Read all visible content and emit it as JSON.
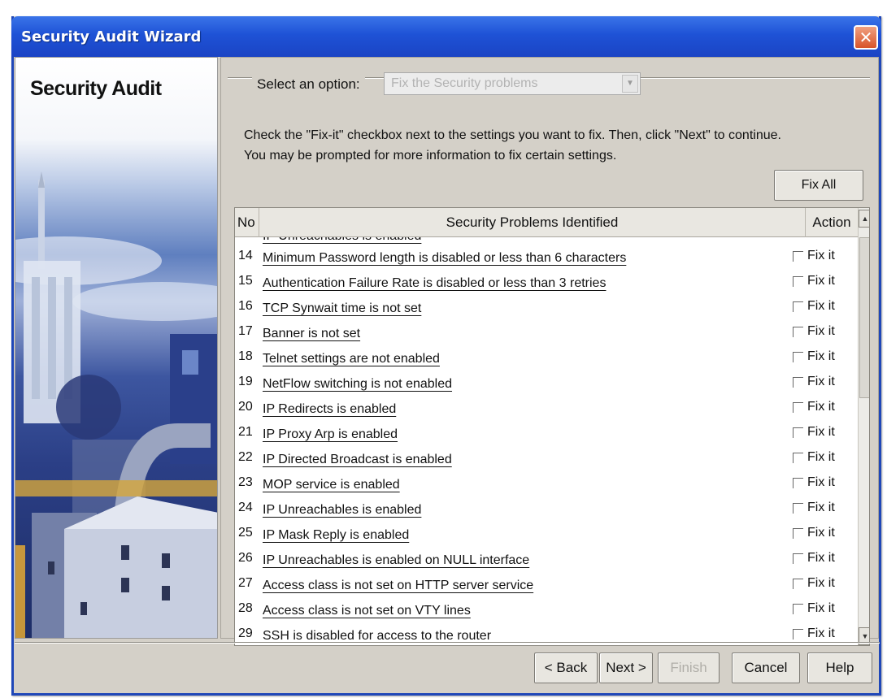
{
  "window": {
    "title": "Security Audit Wizard",
    "close_glyph": "✕"
  },
  "banner": {
    "title": "Security Audit"
  },
  "option": {
    "label": "Select an option:",
    "selected_value": "Fix the Security problems"
  },
  "instructions": {
    "line1": "Check the \"Fix-it\" checkbox next to the settings you want to fix. Then, click \"Next\" to continue.",
    "line2": "You may be prompted for more information to fix certain settings."
  },
  "fix_all_label": "Fix All",
  "table": {
    "headers": {
      "no": "No",
      "problem": "Security Problems Identified",
      "action": "Action"
    },
    "partial_row_text": "IP Unreachables is enabled",
    "rows": [
      {
        "no": "14",
        "problem": "Minimum Password length is disabled or less than 6 characters",
        "action": "Fix it"
      },
      {
        "no": "15",
        "problem": "Authentication Failure Rate is disabled or less than 3 retries",
        "action": "Fix it"
      },
      {
        "no": "16",
        "problem": "TCP Synwait time is not set",
        "action": "Fix it"
      },
      {
        "no": "17",
        "problem": "Banner is not set",
        "action": "Fix it"
      },
      {
        "no": "18",
        "problem": "Telnet settings are not enabled",
        "action": "Fix it"
      },
      {
        "no": "19",
        "problem": "NetFlow switching is not enabled",
        "action": "Fix it"
      },
      {
        "no": "20",
        "problem": "IP Redirects is enabled",
        "action": "Fix it"
      },
      {
        "no": "21",
        "problem": "IP Proxy Arp is enabled",
        "action": "Fix it"
      },
      {
        "no": "22",
        "problem": "IP Directed Broadcast is enabled",
        "action": "Fix it"
      },
      {
        "no": "23",
        "problem": "MOP service is enabled",
        "action": "Fix it"
      },
      {
        "no": "24",
        "problem": "IP Unreachables is enabled",
        "action": "Fix it"
      },
      {
        "no": "25",
        "problem": "IP Mask Reply is enabled",
        "action": "Fix it"
      },
      {
        "no": "26",
        "problem": "IP Unreachables is enabled on NULL interface",
        "action": "Fix it"
      },
      {
        "no": "27",
        "problem": "Access class is not set on HTTP server service",
        "action": "Fix it"
      },
      {
        "no": "28",
        "problem": "Access class is not set on VTY lines",
        "action": "Fix it"
      },
      {
        "no": "29",
        "problem": "SSH is disabled for access to the router",
        "action": "Fix it"
      }
    ]
  },
  "buttons": {
    "back": "< Back",
    "next": "Next >",
    "finish": "Finish",
    "cancel": "Cancel",
    "help": "Help"
  }
}
